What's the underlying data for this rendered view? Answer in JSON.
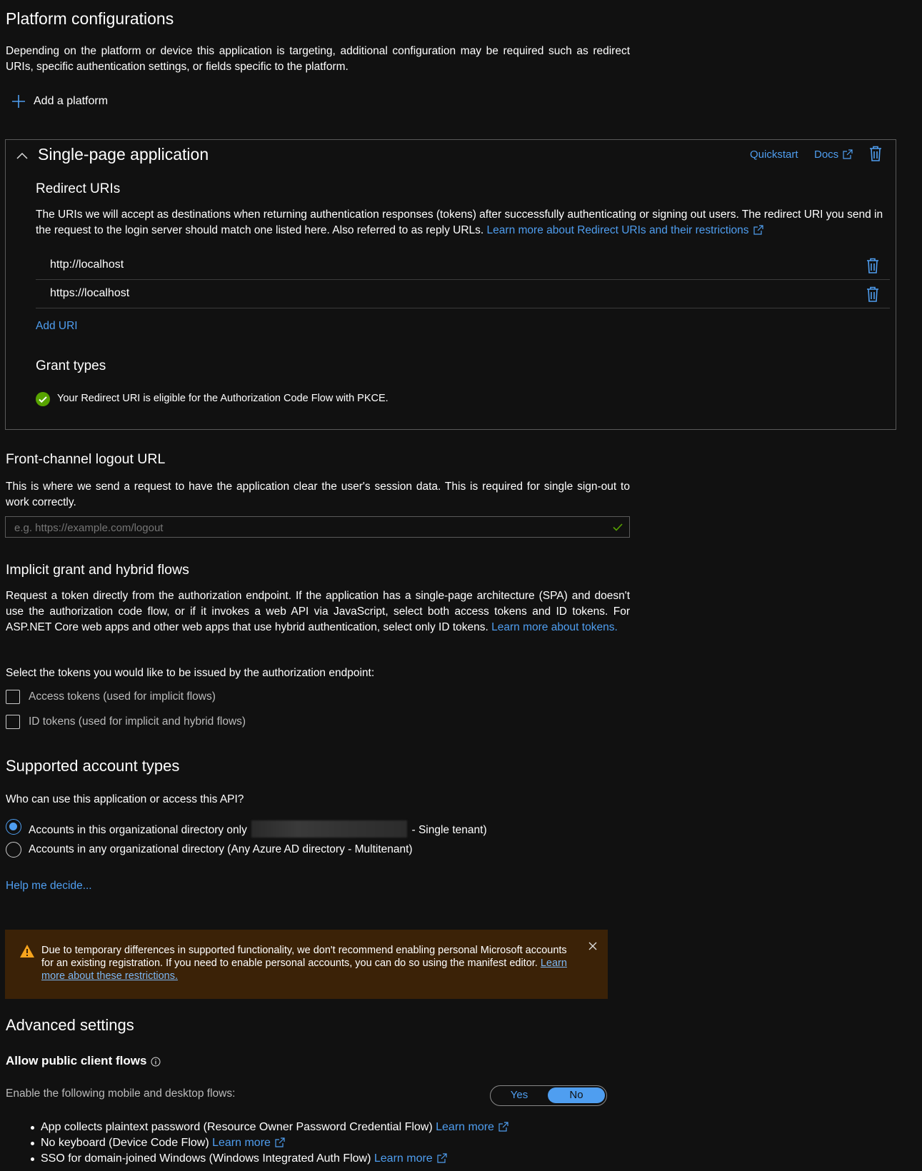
{
  "platform": {
    "title": "Platform configurations",
    "description": "Depending on the platform or device this application is targeting, additional configuration may be required such as redirect URIs, specific authentication settings, or fields specific to the platform.",
    "add_label": "Add a platform"
  },
  "spa": {
    "title": "Single-page application",
    "quickstart": "Quickstart",
    "docs": "Docs",
    "redirect_title": "Redirect URIs",
    "redirect_desc": "The URIs we will accept as destinations when returning authentication responses (tokens) after successfully authenticating or signing out users. The redirect URI you send in the request to the login server should match one listed here. Also referred to as reply URLs.",
    "redirect_link": "Learn more about Redirect URIs and their restrictions",
    "uris": [
      "http://localhost",
      "https://localhost"
    ],
    "add_uri": "Add URI",
    "grant_title": "Grant types",
    "grant_text": "Your Redirect URI is eligible for the Authorization Code Flow with PKCE."
  },
  "logout": {
    "title": "Front-channel logout URL",
    "desc": "This is where we send a request to have the application clear the user's session data. This is required for single sign-out to work correctly.",
    "placeholder": "e.g. https://example.com/logout",
    "value": ""
  },
  "implicit": {
    "title": "Implicit grant and hybrid flows",
    "desc": "Request a token directly from the authorization endpoint. If the application has a single-page architecture (SPA) and doesn't use the authorization code flow, or if it invokes a web API via JavaScript, select both access tokens and ID tokens. For ASP.NET Core web apps and other web apps that use hybrid authentication, select only ID tokens.",
    "link": "Learn more about tokens.",
    "select_label": "Select the tokens you would like to be issued by the authorization endpoint:",
    "access_tokens": "Access tokens (used for implicit flows)",
    "id_tokens": "ID tokens (used for implicit and hybrid flows)",
    "access_checked": false,
    "id_checked": false
  },
  "accounts": {
    "title": "Supported account types",
    "question": "Who can use this application or access this API?",
    "option1_prefix": "Accounts in this organizational directory only",
    "option1_suffix": "- Single tenant)",
    "option2": "Accounts in any organizational directory (Any Azure AD directory - Multitenant)",
    "selected": 1,
    "help": "Help me decide..."
  },
  "warning": {
    "text": "Due to temporary differences in supported functionality, we don't recommend enabling personal Microsoft accounts for an existing registration. If you need to enable personal accounts, you can do so using the manifest editor.",
    "link": "Learn more about these restrictions."
  },
  "advanced": {
    "title": "Advanced settings",
    "public_title": "Allow public client flows",
    "enable_label": "Enable the following mobile and desktop flows:",
    "toggle_yes": "Yes",
    "toggle_no": "No",
    "toggle_value": "No",
    "flows": [
      {
        "text": "App collects plaintext password (Resource Owner Password Credential Flow)",
        "link": "Learn more"
      },
      {
        "text": "No keyboard (Device Code Flow)",
        "link": "Learn more"
      },
      {
        "text": "SSO for domain-joined Windows (Windows Integrated Auth Flow)",
        "link": "Learn more"
      }
    ]
  },
  "colors": {
    "background": "#111111",
    "accent": "#4f9ef0",
    "success": "#57a300",
    "warning_bg": "#3b2207",
    "warning_icon": "#f7a41d"
  }
}
